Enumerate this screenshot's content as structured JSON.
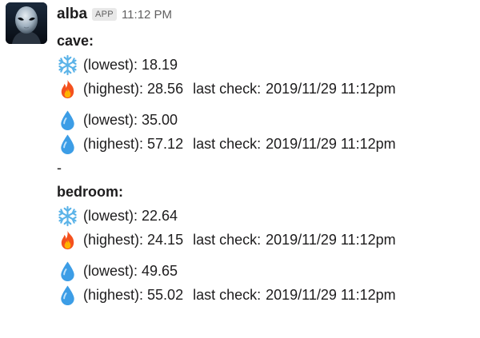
{
  "message": {
    "sender": "alba",
    "badge": "APP",
    "time": "11:12 PM",
    "avatar_icon": "alien-avatar-icon",
    "sections": [
      {
        "title": "cave:",
        "readings": [
          {
            "icon": "snowflake-icon",
            "text": "(lowest): 18.19",
            "last_check_label": "",
            "last_check_value": ""
          },
          {
            "icon": "fire-icon",
            "text": "(highest): 28.56",
            "last_check_label": "last check:",
            "last_check_value": "2019/11/29 11:12pm"
          },
          {
            "icon": "droplet-icon",
            "text": "(lowest): 35.00",
            "last_check_label": "",
            "last_check_value": ""
          },
          {
            "icon": "droplet-icon",
            "text": "(highest): 57.12",
            "last_check_label": "last check:",
            "last_check_value": "2019/11/29 11:12pm"
          }
        ]
      },
      {
        "title": "bedroom:",
        "readings": [
          {
            "icon": "snowflake-icon",
            "text": "(lowest): 22.64",
            "last_check_label": "",
            "last_check_value": ""
          },
          {
            "icon": "fire-icon",
            "text": "(highest): 24.15",
            "last_check_label": "last check:",
            "last_check_value": "2019/11/29 11:12pm"
          },
          {
            "icon": "droplet-icon",
            "text": "(lowest): 49.65",
            "last_check_label": "",
            "last_check_value": ""
          },
          {
            "icon": "droplet-icon",
            "text": "(highest): 55.02",
            "last_check_label": "last check:",
            "last_check_value": "2019/11/29 11:12pm"
          }
        ]
      }
    ],
    "separator": "-"
  },
  "colors": {
    "text": "#1d1c1d",
    "muted": "#616061",
    "droplet": "#3c9de6",
    "fire": "#f4511e",
    "snowflake": "#5bb3e8"
  }
}
